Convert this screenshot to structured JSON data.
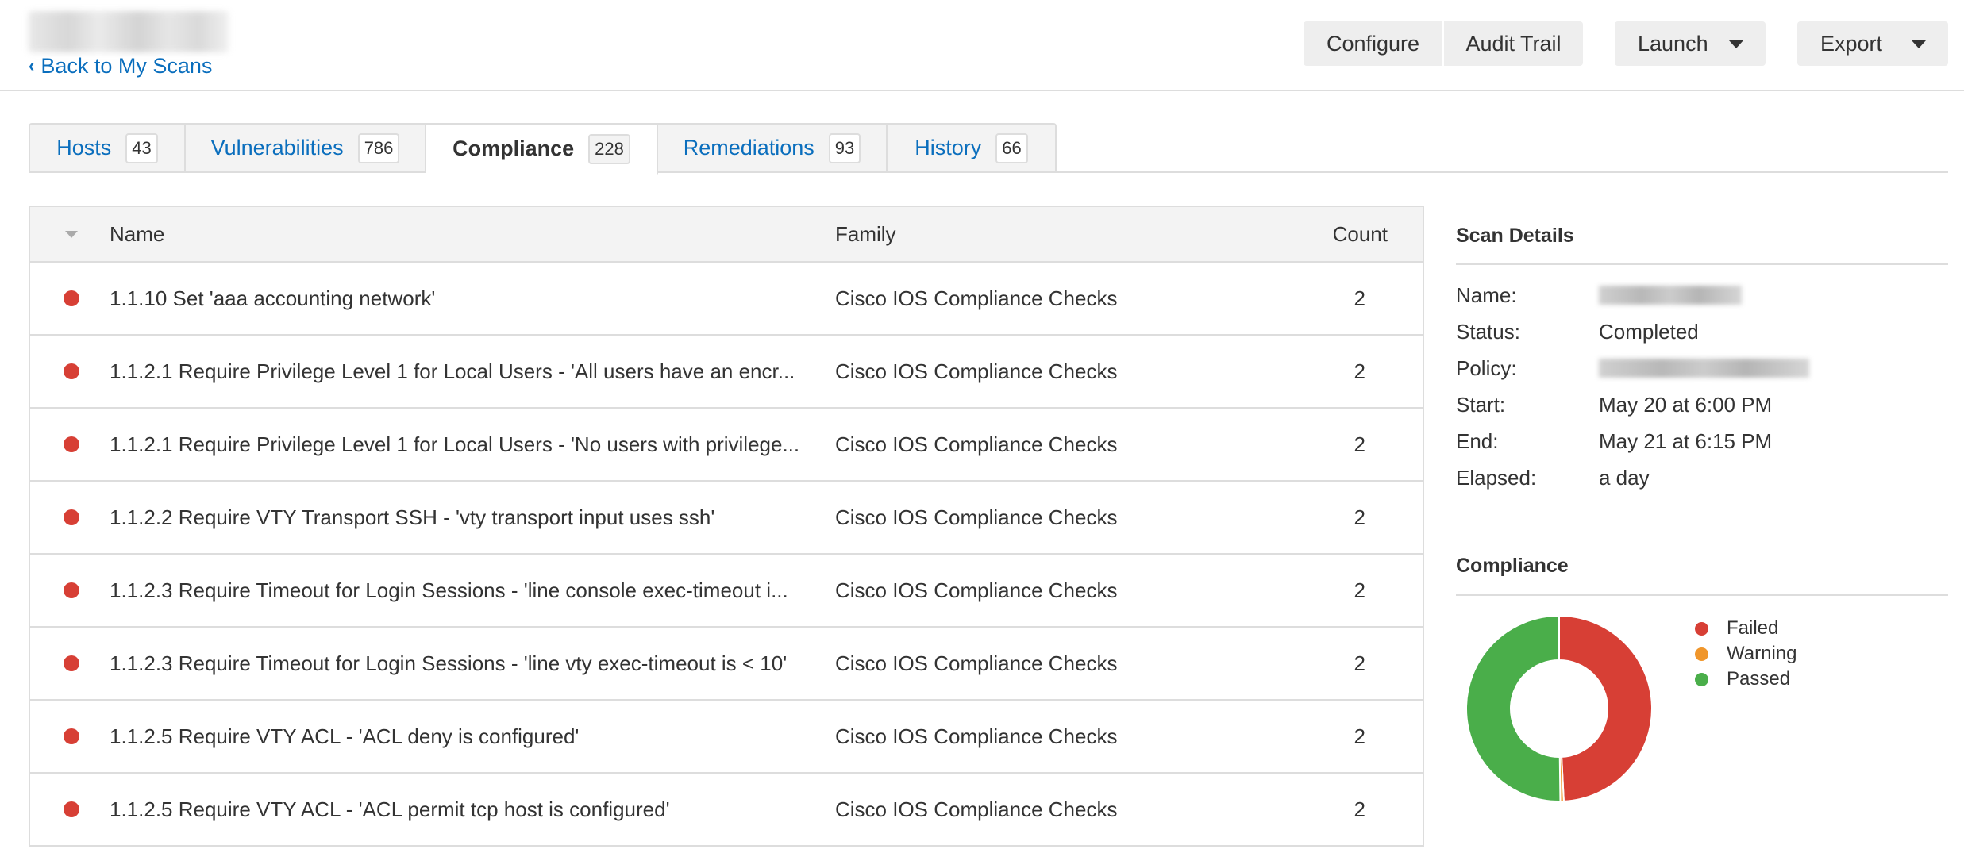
{
  "header": {
    "scan_title": "[redacted scan name]",
    "back_link": "Back to My Scans",
    "buttons": {
      "configure": "Configure",
      "audit_trail": "Audit Trail",
      "launch": "Launch",
      "export": "Export"
    }
  },
  "tabs": [
    {
      "label": "Hosts",
      "count": "43",
      "active": false
    },
    {
      "label": "Vulnerabilities",
      "count": "786",
      "active": false
    },
    {
      "label": "Compliance",
      "count": "228",
      "active": true
    },
    {
      "label": "Remediations",
      "count": "93",
      "active": false
    },
    {
      "label": "History",
      "count": "66",
      "active": false
    }
  ],
  "table": {
    "columns": {
      "name": "Name",
      "family": "Family",
      "count": "Count"
    },
    "status_colors": {
      "failed": "#d73f35",
      "warning": "#f0962b",
      "passed": "#4aae4a"
    },
    "rows": [
      {
        "status": "failed",
        "name": "1.1.10 Set 'aaa accounting network'",
        "family": "Cisco IOS Compliance Checks",
        "count": "2"
      },
      {
        "status": "failed",
        "name": "1.1.2.1 Require Privilege Level 1 for Local Users - 'All users have an encr...",
        "family": "Cisco IOS Compliance Checks",
        "count": "2"
      },
      {
        "status": "failed",
        "name": "1.1.2.1 Require Privilege Level 1 for Local Users - 'No users with privilege...",
        "family": "Cisco IOS Compliance Checks",
        "count": "2"
      },
      {
        "status": "failed",
        "name": "1.1.2.2 Require VTY Transport SSH - 'vty transport input uses ssh'",
        "family": "Cisco IOS Compliance Checks",
        "count": "2"
      },
      {
        "status": "failed",
        "name": "1.1.2.3 Require Timeout for Login Sessions - 'line console exec-timeout i...",
        "family": "Cisco IOS Compliance Checks",
        "count": "2"
      },
      {
        "status": "failed",
        "name": "1.1.2.3 Require Timeout for Login Sessions - 'line vty exec-timeout is < 10'",
        "family": "Cisco IOS Compliance Checks",
        "count": "2"
      },
      {
        "status": "failed",
        "name": "1.1.2.5 Require VTY ACL - 'ACL deny is configured'",
        "family": "Cisco IOS Compliance Checks",
        "count": "2"
      },
      {
        "status": "failed",
        "name": "1.1.2.5 Require VTY ACL - 'ACL permit tcp host is configured'",
        "family": "Cisco IOS Compliance Checks",
        "count": "2"
      }
    ]
  },
  "scan_details": {
    "title": "Scan Details",
    "items": [
      {
        "label": "Name:",
        "value": "",
        "redacted": true
      },
      {
        "label": "Status:",
        "value": "Completed",
        "redacted": false
      },
      {
        "label": "Policy:",
        "value": "",
        "redacted": true
      },
      {
        "label": "Start:",
        "value": "May 20 at 6:00 PM",
        "redacted": false
      },
      {
        "label": "End:",
        "value": "May 21 at 6:15 PM",
        "redacted": false
      },
      {
        "label": "Elapsed:",
        "value": "a day",
        "redacted": false
      }
    ]
  },
  "compliance_panel": {
    "title": "Compliance"
  },
  "chart_data": {
    "type": "pie",
    "variant": "donut",
    "title": "Compliance",
    "categories": [
      "Failed",
      "Warning",
      "Passed"
    ],
    "values": [
      49.2,
      0.6,
      50.2
    ],
    "unit": "percent (estimated from slice angles)",
    "colors": [
      "#d73f35",
      "#f0962b",
      "#4aae4a"
    ],
    "legend": "right"
  }
}
